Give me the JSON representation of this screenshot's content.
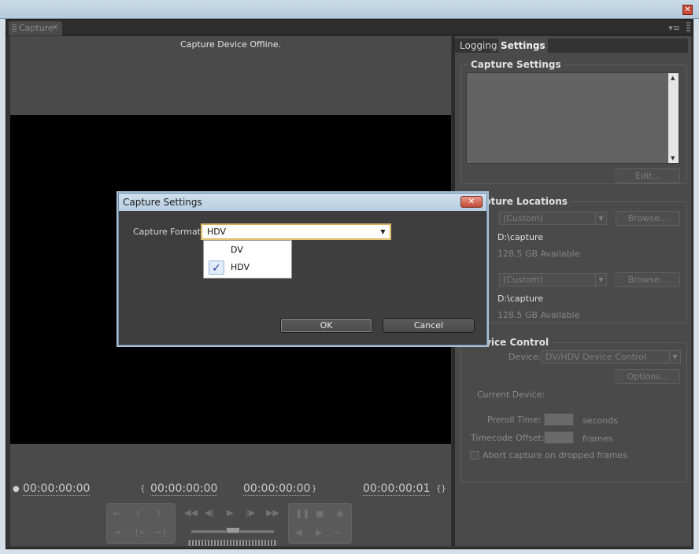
{
  "window": {
    "close_glyph": "✕"
  },
  "tabs": {
    "capture": "Capture",
    "capture_close": "✕",
    "panel_menu": "▾≡"
  },
  "capture": {
    "status": "Capture Device Offline.",
    "timecodes": {
      "current": "00:00:00:00",
      "in": "00:00:00:00",
      "out": "00:00:00:00",
      "duration": "00:00:00:01"
    }
  },
  "right_panel": {
    "tabs": [
      "Logging",
      "Settings"
    ],
    "capture_settings": {
      "title": "Capture Settings",
      "edit_label": "Edit..."
    },
    "capture_locations": {
      "title": "Capture Locations",
      "video_combo": "(Custom)",
      "browse_label": "Browse...",
      "video_path": "D:\\capture",
      "video_available": "128.5 GB Available",
      "audio_combo": "(Custom)",
      "audio_path": "D:\\capture",
      "audio_available": "128.5 GB Available"
    },
    "device_control": {
      "title": "Device Control",
      "device_label": "Device:",
      "device_value": "DV/HDV Device Control",
      "options_label": "Options...",
      "current_device_label": "Current Device:",
      "preroll_label": "Preroll Time:",
      "preroll_unit": "seconds",
      "tc_offset_label": "Timecode Offset:",
      "tc_offset_unit": "frames",
      "abort_label": "Abort capture on dropped frames"
    }
  },
  "dialog": {
    "title": "Capture Settings",
    "close_glyph": "✕",
    "format_label": "Capture Format:",
    "format_value": "HDV",
    "options": [
      {
        "label": "DV",
        "checked": false
      },
      {
        "label": "HDV",
        "checked": true
      }
    ],
    "ok_label": "OK",
    "cancel_label": "Cancel"
  }
}
